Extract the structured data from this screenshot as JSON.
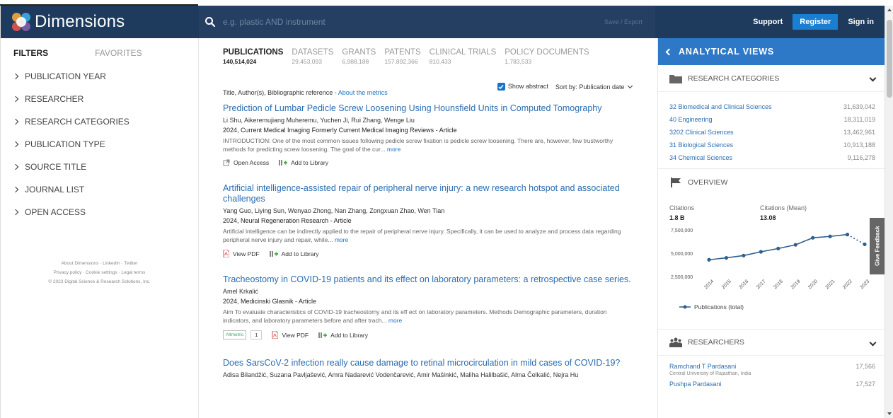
{
  "header": {
    "brand": "Dimensions",
    "search_placeholder": "e.g. plastic AND instrument",
    "save_export": "Save / Export",
    "support": "Support",
    "register": "Register",
    "sign_in": "Sign in"
  },
  "filters": {
    "tab_filters": "FILTERS",
    "tab_favorites": "FAVORITES",
    "items": [
      {
        "label": "PUBLICATION YEAR"
      },
      {
        "label": "RESEARCHER"
      },
      {
        "label": "RESEARCH CATEGORIES"
      },
      {
        "label": "PUBLICATION TYPE"
      },
      {
        "label": "SOURCE TITLE"
      },
      {
        "label": "JOURNAL LIST"
      },
      {
        "label": "OPEN ACCESS"
      }
    ],
    "footer_line1": "About Dimensions · LinkedIn · Twitter",
    "footer_line2": "Privacy policy · Cookie settings · Legal terms",
    "footer_line3": "© 2023 Digital Science & Research Solutions, Inc."
  },
  "types": [
    {
      "label": "PUBLICATIONS",
      "count": "140,514,024"
    },
    {
      "label": "DATASETS",
      "count": "29,453,093"
    },
    {
      "label": "GRANTS",
      "count": "6,988,188"
    },
    {
      "label": "PATENTS",
      "count": "157,892,366"
    },
    {
      "label": "CLINICAL TRIALS",
      "count": "810,433"
    },
    {
      "label": "POLICY DOCUMENTS",
      "count": "1,783,533"
    }
  ],
  "sort": {
    "show_abstract": "Show abstract",
    "sort_by": "Sort by: Publication date"
  },
  "metrics_line": {
    "prefix": "Title, Author(s), Bibliographic reference - ",
    "link": "About the metrics"
  },
  "publications": [
    {
      "title": "Prediction of Lumbar Pedicle Screw Loosening Using Hounsfield Units in Computed Tomography",
      "authors": "Li Shu, Aikeremujiang Muheremu, Yuchen Ji, Rui Zhang, Wenge Liu",
      "source": "2024, Current Medical Imaging Formerly Current Medical Imaging Reviews - Article",
      "abstract": "INTRODUCTION: One of the most common issues following pedicle screw fixation is pedicle screw loosening. There are, however, few trustworthy methods for predicting screw loosening. The goal of the cur...",
      "more": "more",
      "action1": "Open Access",
      "action2": "Add to Library"
    },
    {
      "title": "Artificial intelligence-assisted repair of peripheral nerve injury: a new research hotspot and associated challenges",
      "authors": "Yang Guo, Liying Sun, Wenyao Zhong, Nan Zhang, Zongxuan Zhao, Wen Tian",
      "source": "2024, Neural Regeneration Research - Article",
      "abstract": "Artificial intelligence can be indirectly applied to the repair of peripheral nerve injury. Specifically, it can be used to analyze and process data regarding peripheral nerve injury and repair, while...",
      "more": "more",
      "action1": "View PDF",
      "action2": "Add to Library"
    },
    {
      "title": "Tracheostomy in COVID-19 patients and its effect on laboratory parameters: a retrospective case series.",
      "authors": "Amel Krkalić",
      "source": "2024, Medicinski Glasnik - Article",
      "abstract": "Aim To evaluate characteristics of COVID-19 tracheostomy and its eff ect on laboratory parameters. Methods Demographic parameters, duration indicators, and laboratory parameters before and after trach...",
      "more": "more",
      "altmetric": "Altmetric",
      "altmetric_score": "1",
      "action1": "View PDF",
      "action2": "Add to Library"
    },
    {
      "title": "Does SarsCoV-2 infection really cause damage to retinal microcirculation in mild cases of COVID-19?",
      "authors": "Adisa Bilandžić, Suzana Pavljašević, Amra Nadarević Vodenčarević, Amir Mašinkić, Maliha Halilbašić, Alma Čelkalić, Nejra Hu"
    }
  ],
  "analytics": {
    "title": "ANALYTICAL VIEWS",
    "research_categories": {
      "title": "RESEARCH CATEGORIES",
      "rows": [
        {
          "name": "32 Biomedical and Clinical Sciences",
          "value": "31,639,042"
        },
        {
          "name": "40 Engineering",
          "value": "18,311,019"
        },
        {
          "name": "3202 Clinical Sciences",
          "value": "13,462,961"
        },
        {
          "name": "31 Biological Sciences",
          "value": "10,913,188"
        },
        {
          "name": "34 Chemical Sciences",
          "value": "9,116,278"
        }
      ]
    },
    "overview": {
      "title": "OVERVIEW",
      "citations_label": "Citations",
      "citations_value": "1.8 B",
      "citations_mean_label": "Citations (Mean)",
      "citations_mean_value": "13.08"
    },
    "researchers": {
      "title": "RESEARCHERS",
      "rows": [
        {
          "name": "Ramchand T Pardasani",
          "affiliation": "Central University of Rajasthan, India",
          "value": "17,566"
        },
        {
          "name": "Pushpa Pardasani",
          "affiliation": "",
          "value": "17,527"
        }
      ]
    },
    "feedback": "Give Feedback"
  },
  "chart_data": {
    "type": "line",
    "title": "",
    "xlabel": "",
    "ylabel": "",
    "x": [
      "2014",
      "2015",
      "2016",
      "2017",
      "2018",
      "2019",
      "2020",
      "2021",
      "2022",
      "2023"
    ],
    "series": [
      {
        "name": "Publications (total)",
        "values": [
          4300000,
          4500000,
          4750000,
          5150000,
          5500000,
          5900000,
          6650000,
          6800000,
          7000000,
          5950000
        ],
        "dashed_last_segment": true
      }
    ],
    "yticks": [
      "7,500,000",
      "5,000,000",
      "2,500,000"
    ],
    "ytick_values": [
      7500000,
      5000000,
      2500000
    ],
    "ylim": [
      2500000,
      7500000
    ],
    "grid": false,
    "legend": "bottom-left",
    "color": "#2f5f8f"
  }
}
